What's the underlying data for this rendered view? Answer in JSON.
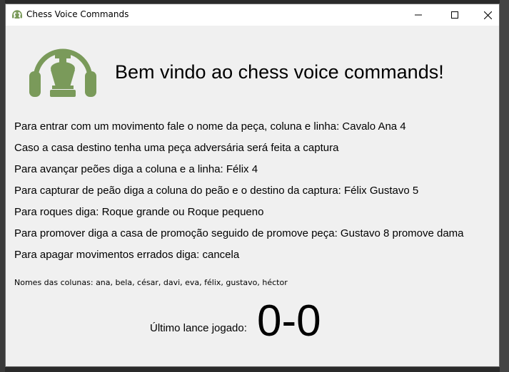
{
  "window": {
    "title": "Chess Voice Commands",
    "accent_color": "#7a9a5a"
  },
  "header": {
    "logo_icon": "chess-king-headphones-icon",
    "welcome": "Bem vindo ao chess voice commands!"
  },
  "instructions": [
    "Para entrar com um movimento fale o nome da peça, coluna e linha: Cavalo Ana 4",
    "Caso a casa destino tenha uma peça adversária será feita a captura",
    "Para avançar peões diga a coluna e a linha: Félix 4",
    "Para capturar de peão diga a coluna do peão e o destino da captura: Félix Gustavo 5",
    "Para roques diga: Roque grande ou Roque pequeno",
    "Para promover diga a casa de promoção seguido de promove peça: Gustavo 8 promove dama",
    "Para apagar movimentos errados diga: cancela"
  ],
  "columns_note": "Nomes das colunas: ana, bela, césar, davi, eva, félix, gustavo, héctor",
  "last_move": {
    "label": "Último lance jogado:",
    "value": "0-0"
  }
}
